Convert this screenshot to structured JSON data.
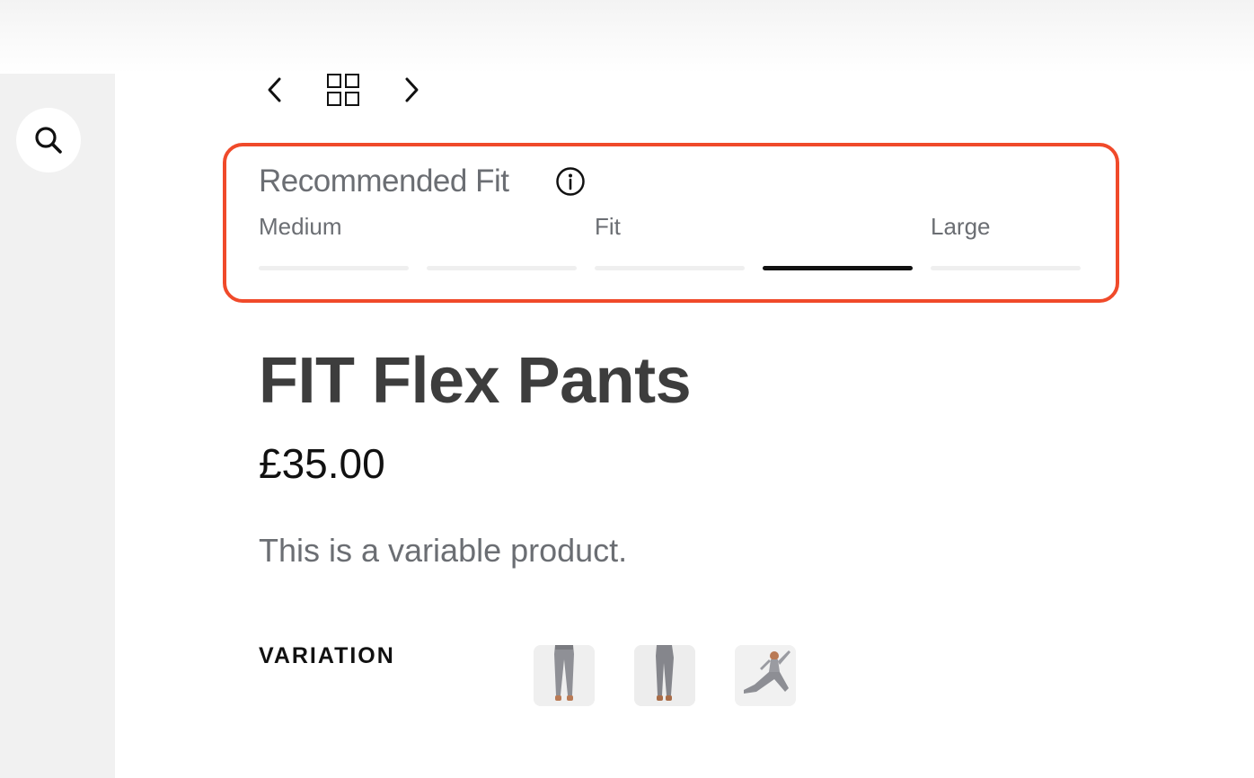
{
  "navigation": {
    "prev_icon": "chevron-left-icon",
    "grid_icon": "grid-icon",
    "next_icon": "chevron-right-icon",
    "search_icon": "search-icon"
  },
  "fit": {
    "title": "Recommended Fit",
    "info_icon": "info-icon",
    "labels": [
      "Medium",
      "Fit",
      "Large"
    ],
    "segments": 5,
    "active_segment_index": 3,
    "highlight_color": "#f04a2a"
  },
  "product": {
    "title": "FIT Flex Pants",
    "price": "£35.00",
    "description": "This is a variable product."
  },
  "variation": {
    "label": "VARIATION",
    "swatches": [
      "pants-front-image",
      "pants-side-image",
      "pants-stretch-image"
    ]
  }
}
